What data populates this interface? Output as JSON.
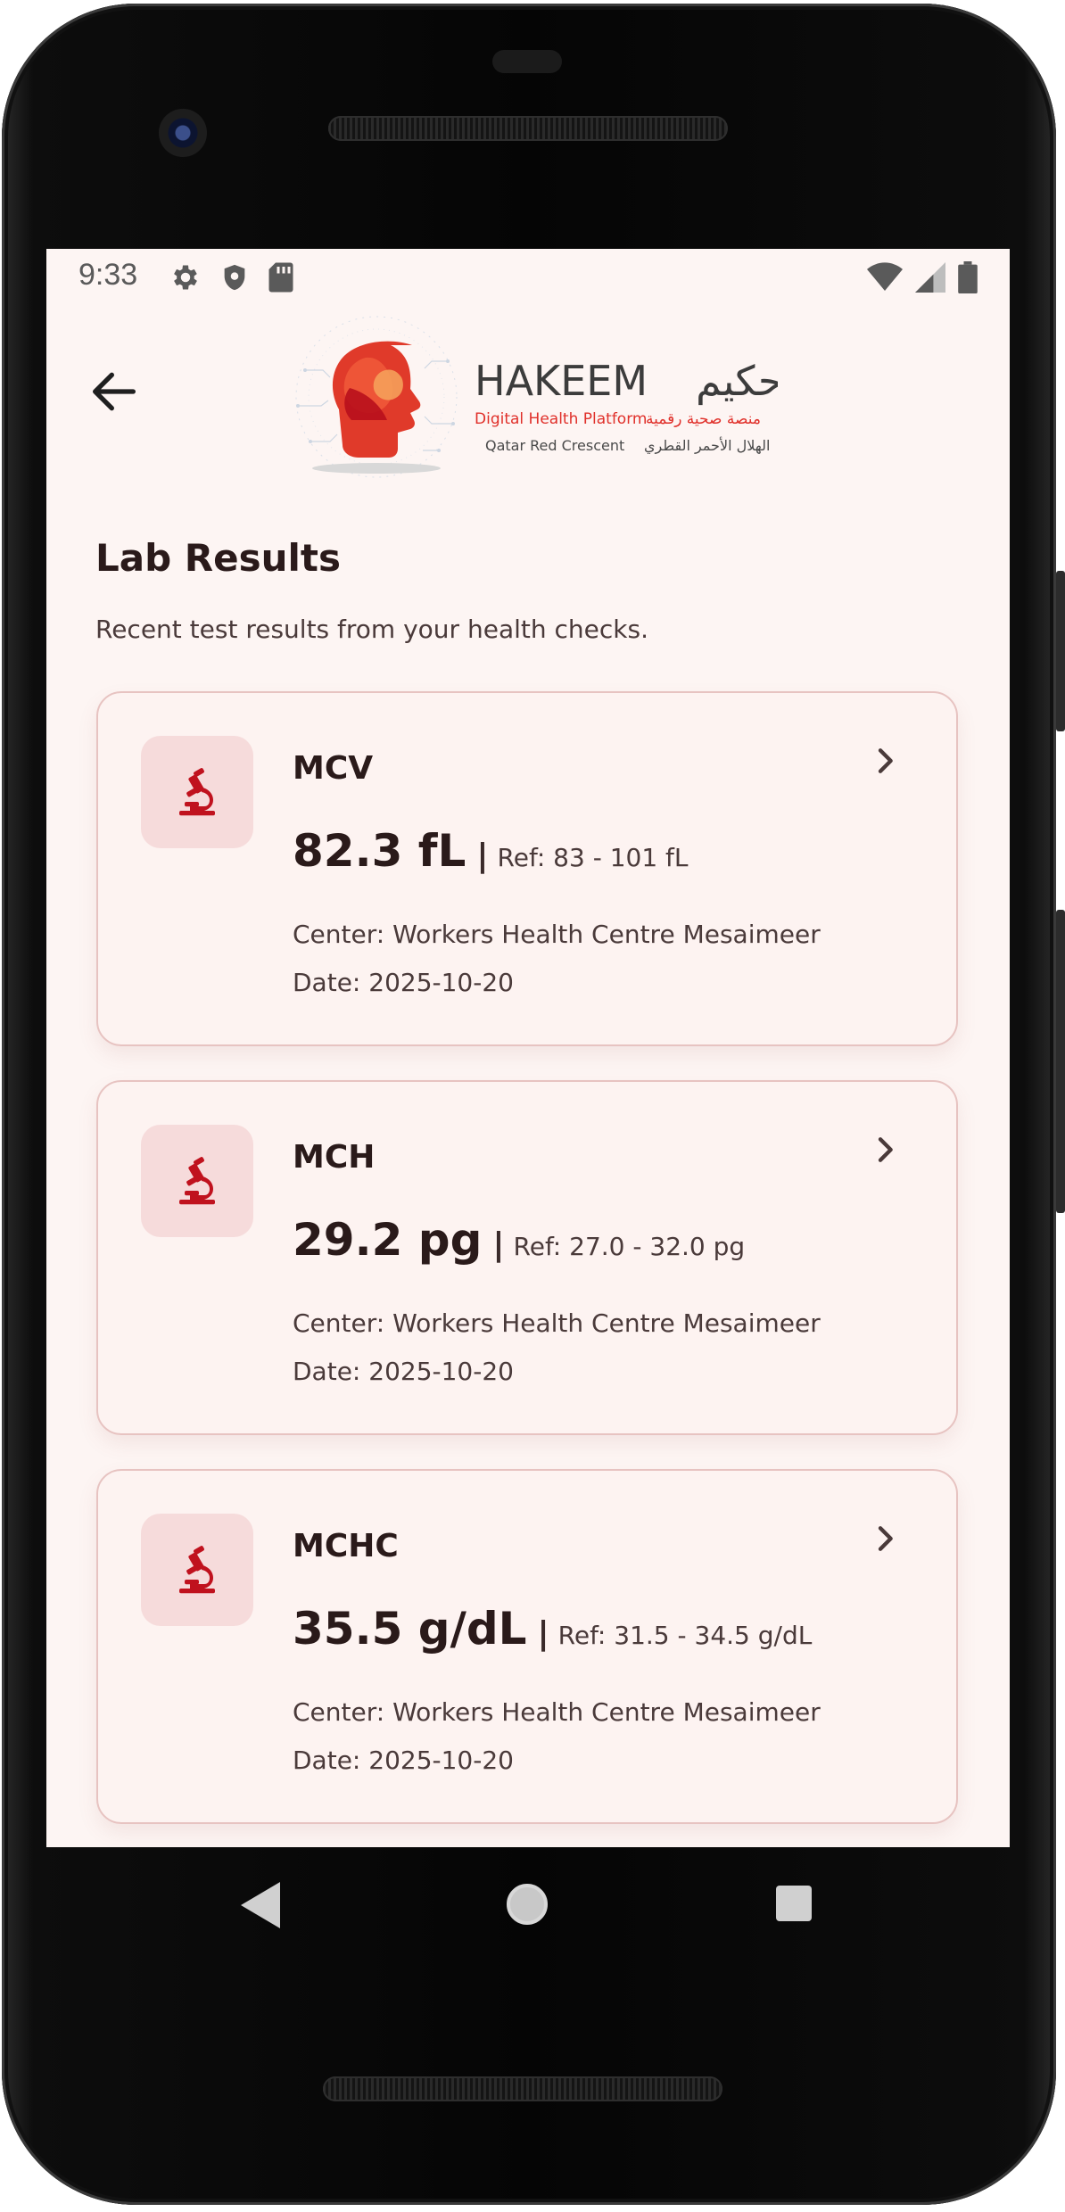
{
  "status_bar": {
    "time": "9:33",
    "left_icons": [
      "gear-icon",
      "shield-icon",
      "sd-card-icon"
    ],
    "right_icons": [
      "wifi-icon",
      "signal-icon",
      "battery-icon"
    ]
  },
  "header": {
    "back_icon": "arrow-left-icon",
    "logo": {
      "name_en": "HAKEEM",
      "name_ar": "حكيم",
      "tagline_en": "Digital Health Platform",
      "tagline_ar": "منصة صحية رقمية",
      "org_en": "Qatar Red Crescent",
      "org_ar": "الهلال الأحمر القطري"
    }
  },
  "page": {
    "title": "Lab Results",
    "subtitle": "Recent test results from your health checks."
  },
  "results": [
    {
      "name": "MCV",
      "value": "82.3 fL",
      "separator": "|",
      "ref": "Ref: 83 - 101 fL",
      "center": "Center: Workers Health Centre Mesaimeer",
      "date": "Date: 2025-10-20"
    },
    {
      "name": "MCH",
      "value": "29.2 pg",
      "separator": "|",
      "ref": "Ref: 27.0 - 32.0 pg",
      "center": "Center: Workers Health Centre Mesaimeer",
      "date": "Date: 2025-10-20"
    },
    {
      "name": "MCHC",
      "value": "35.5 g/dL",
      "separator": "|",
      "ref": "Ref: 31.5 - 34.5 g/dL",
      "center": "Center: Workers Health Centre Mesaimeer",
      "date": "Date: 2025-10-20"
    }
  ],
  "colors": {
    "screen_bg": "#fdf5f3",
    "card_bg": "#fdf3f1",
    "card_border": "#e7c3c1",
    "icon_bg": "#f6dbdb",
    "accent_red": "#c0121e",
    "text_dark": "#2a1a1a"
  },
  "navigation_bar": {
    "icons": [
      "nav-back-icon",
      "nav-home-icon",
      "nav-recents-icon"
    ]
  }
}
